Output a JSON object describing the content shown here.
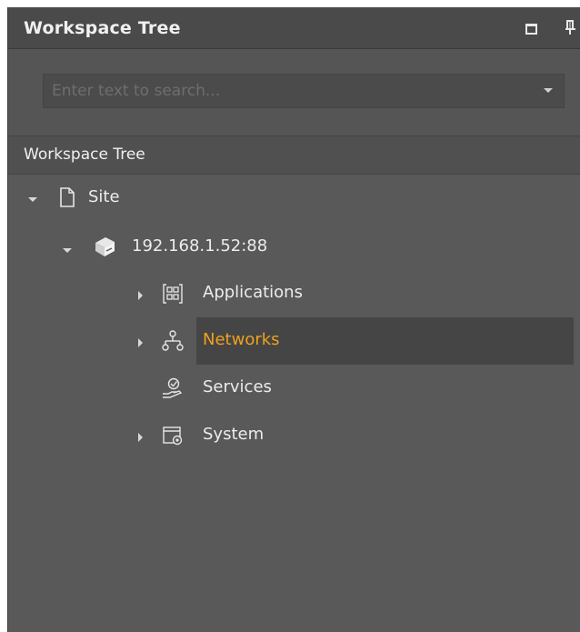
{
  "panel": {
    "title": "Workspace Tree",
    "float_icon": "restore-window-icon",
    "pin_icon": "pin-icon"
  },
  "search": {
    "value": "",
    "placeholder": "Enter text to search..."
  },
  "section": {
    "title": "Workspace Tree"
  },
  "tree": {
    "site": {
      "label": "Site",
      "icon": "page-icon",
      "expanded": true
    },
    "server": {
      "label": "192.168.1.52:88",
      "icon": "server-icon",
      "expanded": true
    },
    "applications": {
      "label": "Applications",
      "icon": "applications-icon",
      "expanded": false
    },
    "networks": {
      "label": "Networks",
      "icon": "network-icon",
      "expanded": false,
      "selected": true
    },
    "services": {
      "label": "Services",
      "icon": "services-icon"
    },
    "system": {
      "label": "System",
      "icon": "system-icon",
      "expanded": false
    }
  },
  "colors": {
    "panel_bg": "#595959",
    "title_bg": "#4a4a4a",
    "selected_row": "#454545",
    "selected_text": "#f0a020",
    "text": "#ececec"
  }
}
